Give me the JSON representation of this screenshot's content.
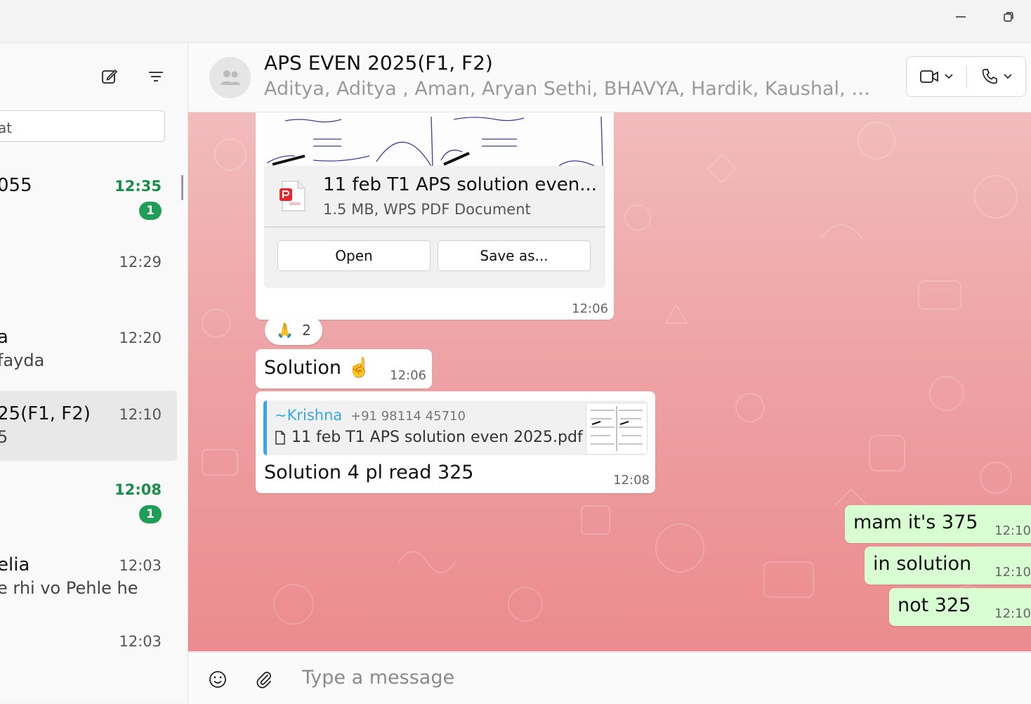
{
  "window": {
    "minimize_icon": "minimize-icon",
    "restore_icon": "restore-icon"
  },
  "sidebar": {
    "search_placeholder": "at",
    "chats": [
      {
        "name": "055",
        "preview": "",
        "time": "12:35",
        "unread": "1"
      },
      {
        "name": "",
        "preview": "",
        "time": "12:29",
        "unread": ""
      },
      {
        "name": "a",
        "preview": "fayda",
        "time": "12:20",
        "unread": ""
      },
      {
        "name": "25(F1, F2)",
        "preview": "5",
        "time": "12:10",
        "unread": "",
        "selected": true
      },
      {
        "name": "",
        "preview": "",
        "time": "12:08",
        "unread": "1"
      },
      {
        "name": "elia",
        "preview": "e rhi vo Pehle he",
        "time": "12:03",
        "unread": ""
      },
      {
        "name": "",
        "preview": "",
        "time": "12:03",
        "unread": ""
      }
    ]
  },
  "header": {
    "title": "APS EVEN 2025(F1, F2)",
    "members": "Aditya, Aditya , Aman, Aryan Sethi, BHAVYA, Hardik, Kaushal, Krishna..."
  },
  "messages": {
    "document": {
      "file_name": "11 feb T1 APS solution even...",
      "file_meta": "1.5 MB, WPS PDF Document",
      "open_label": "Open",
      "save_label": "Save as...",
      "time": "12:06"
    },
    "reaction": {
      "emoji": "🙏",
      "count": "2"
    },
    "solution": {
      "text": "Solution ☝️",
      "time": "12:06"
    },
    "reply": {
      "author": "~Krishna",
      "phone": "+91 98114 45710",
      "file": "11 feb T1 APS solution even 2025.pdf",
      "text": "Solution 4 pl read 325",
      "time": "12:08"
    },
    "outgoing": [
      {
        "text": "mam it's 375",
        "time": "12:10"
      },
      {
        "text": "in solution",
        "time": "12:10"
      },
      {
        "text": "not 325",
        "time": "12:10"
      }
    ]
  },
  "composer": {
    "placeholder": "Type a message"
  },
  "colors": {
    "unread_green": "#1a8d4a",
    "badge_green": "#1f9e55",
    "outgoing_bubble": "#d9fdd3",
    "quote_accent": "#35a7e6",
    "chat_bg_top": "#f2bcbc",
    "chat_bg_bottom": "#eb8b8f"
  }
}
